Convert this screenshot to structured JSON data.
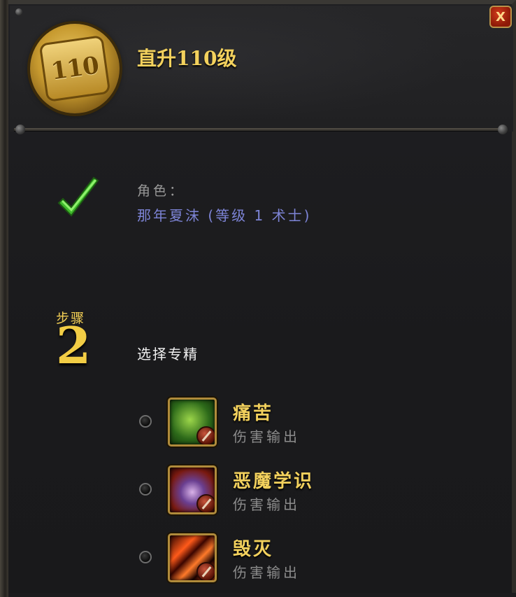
{
  "header": {
    "title": "直升110级",
    "badge_number": "110",
    "close_label": "X"
  },
  "character": {
    "label": "角色：",
    "value": "那年夏沫 (等级 1 术士)",
    "complete": true
  },
  "step": {
    "label": "步骤",
    "number": "2",
    "title": "选择专精"
  },
  "specs": [
    {
      "name": "痛苦",
      "role": "伤害输出",
      "icon": "affliction-icon",
      "selected": false
    },
    {
      "name": "恶魔学识",
      "role": "伤害输出",
      "icon": "demonology-icon",
      "selected": false
    },
    {
      "name": "毁灭",
      "role": "伤害输出",
      "icon": "destruction-icon",
      "selected": false
    }
  ],
  "colors": {
    "gold": "#f3d15d",
    "character_blue": "#7d84d6",
    "muted": "#8c8c8c",
    "check_green": "#3fb92c"
  }
}
